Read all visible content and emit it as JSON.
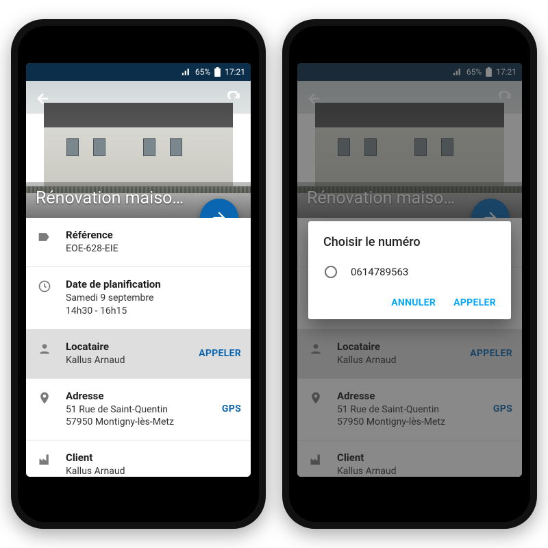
{
  "status": {
    "signal_pct": "65%",
    "time": "17:21"
  },
  "header": {
    "title": "Rénovation maiso…"
  },
  "items": {
    "reference": {
      "label": "Référence",
      "value": "EOE-628-EIE"
    },
    "date": {
      "label": "Date de planification",
      "line1": "Samedi 9 septembre",
      "line2": "14h30 - 16h15"
    },
    "tenant": {
      "label": "Locataire",
      "value": "Kallus Arnaud",
      "action": "APPELER"
    },
    "address": {
      "label": "Adresse",
      "line1": "51 Rue de Saint-Quentin",
      "line2": "57950 Montigny-lès-Metz",
      "action": "GPS"
    },
    "client": {
      "label": "Client",
      "value": "Kallus Arnaud"
    }
  },
  "dialog": {
    "title": "Choisir le numéro",
    "options": [
      {
        "number": "0614789563"
      }
    ],
    "cancel": "ANNULER",
    "confirm": "APPELER"
  }
}
